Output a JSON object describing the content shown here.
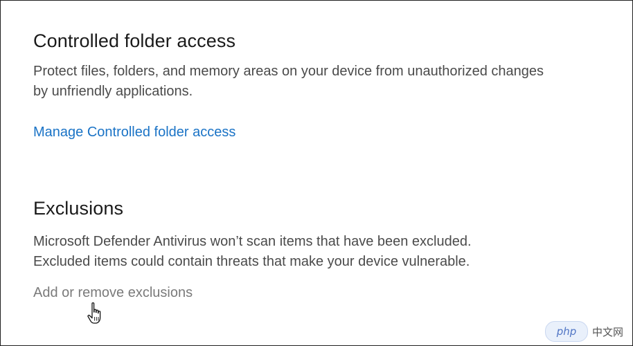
{
  "controlled_folder_access": {
    "title": "Controlled folder access",
    "description": "Protect files, folders, and memory areas on your device from unauthorized changes by unfriendly applications.",
    "link": "Manage Controlled folder access"
  },
  "exclusions": {
    "title": "Exclusions",
    "description_line1": "Microsoft Defender Antivirus won’t scan items that have been excluded.",
    "description_line2": "Excluded items could contain threats that make your device vulnerable.",
    "link": "Add or remove exclusions"
  },
  "watermark": {
    "logo": "php",
    "site": "中文网"
  },
  "colors": {
    "link": "#1a73c6",
    "link_hover": "#7a7a7a",
    "title": "#1a1a1a",
    "description": "#4a4a4a"
  },
  "icons": {
    "pointer": "hand-pointer-icon"
  }
}
